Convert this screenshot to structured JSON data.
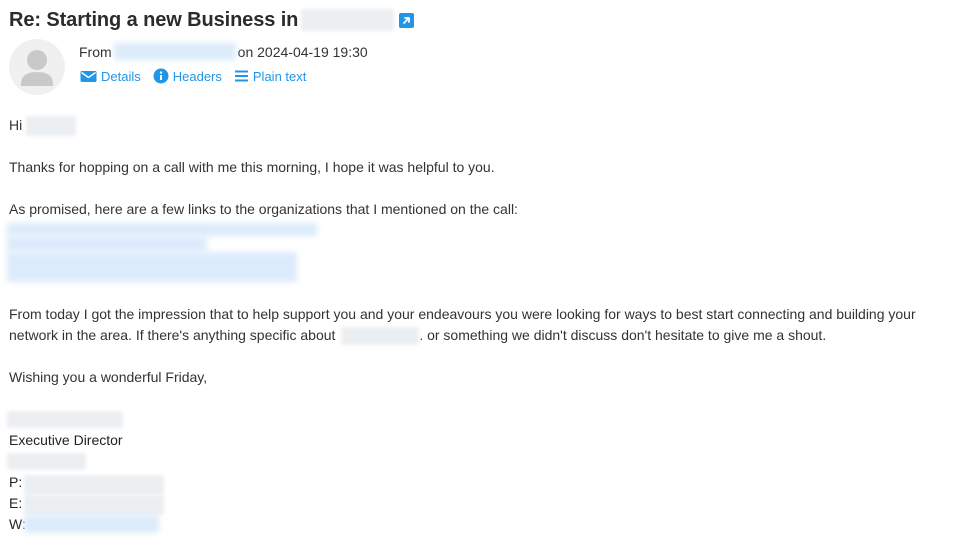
{
  "email": {
    "subject": "Re: Starting a new Business in",
    "from_label": "From",
    "date_text": "on 2024-04-19 19:30",
    "actions": {
      "details": "Details",
      "headers": "Headers",
      "plain_text": "Plain text"
    },
    "body": {
      "greeting": "Hi",
      "para1": "Thanks for hopping on a call with me this morning, I hope it was helpful to you.",
      "para2": "As promised, here are a few links to the organizations that I mentioned on the call:",
      "para3_line1": "From today I got the impression that to help support you and your endeavours you were looking for ways to best start connecting and building your",
      "para3_line2_start": "network in the area. If there's anything specific about",
      "para3_line2_end": ". or something we didn't discuss don't hesitate to give me a shout.",
      "closing": "Wishing you a wonderful Friday,"
    },
    "signature": {
      "title": "Executive Director",
      "phone_label": "P:",
      "email_label": "E:",
      "web_label": "W:"
    }
  },
  "icons": {
    "open_new": "open-in-new-window-icon",
    "details": "envelope-icon",
    "headers": "info-icon",
    "plain_text": "lines-icon",
    "avatar": "person-silhouette-icon"
  },
  "colors": {
    "accent": "#2196e6",
    "text": "#333333",
    "avatar_bg": "#f0f0f0",
    "avatar_fg": "#c9c9c9"
  }
}
